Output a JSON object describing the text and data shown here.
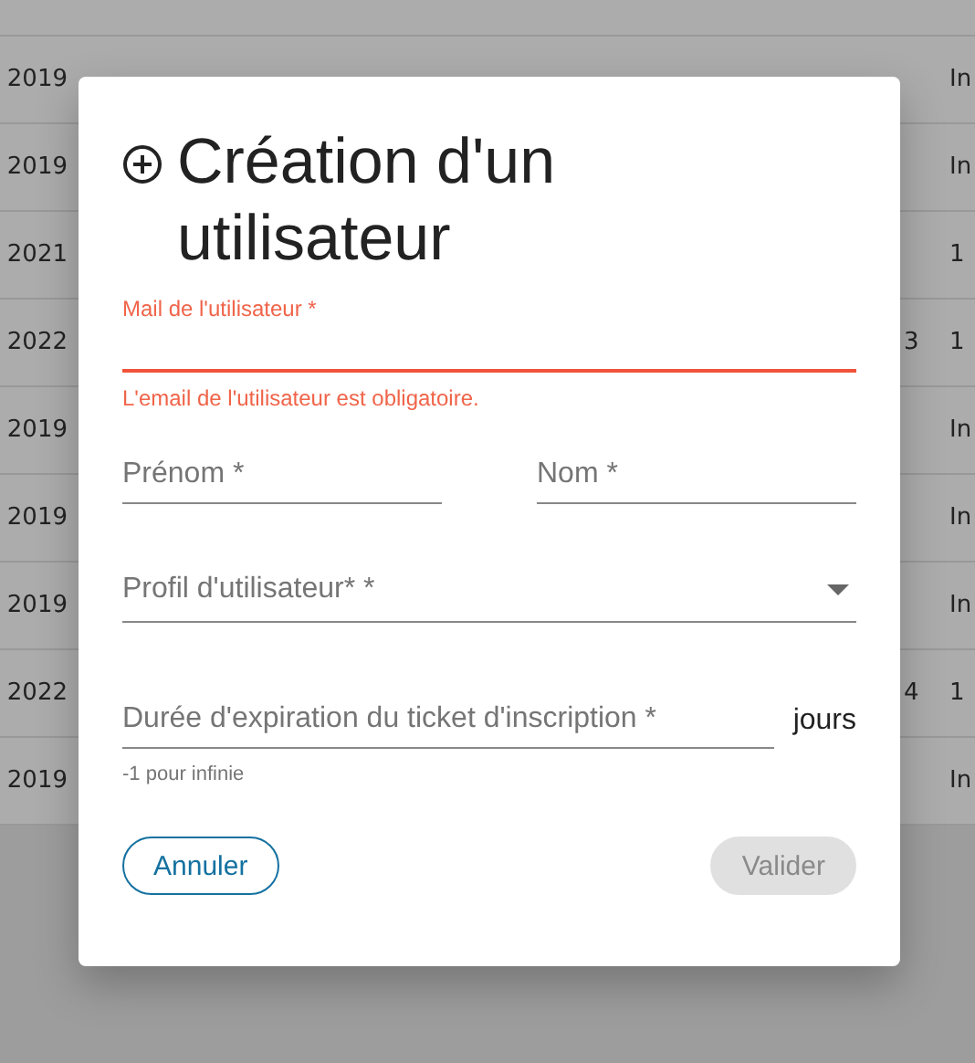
{
  "background_table": {
    "rows": [
      {
        "column_1": "2019",
        "column_3": "In"
      },
      {
        "column_1": "2019",
        "column_3": "In"
      },
      {
        "column_1": "2021",
        "column_3": "1"
      },
      {
        "column_1": "2022",
        "column_2": "3",
        "column_3": "1"
      },
      {
        "column_1": "2019",
        "column_3": "In"
      },
      {
        "column_1": "2019",
        "column_3": "In"
      },
      {
        "column_1": "2019",
        "column_3": "In"
      },
      {
        "column_1": "2022",
        "column_2": "4",
        "column_3": "1"
      },
      {
        "column_1": "2019",
        "column_3": "In"
      }
    ]
  },
  "dialog": {
    "title": "Création d'un utilisateur",
    "email": {
      "label": "Mail de l'utilisateur *",
      "error": "L'email de l'utilisateur est obligatoire."
    },
    "first_name": {
      "placeholder": "Prénom *"
    },
    "last_name": {
      "placeholder": "Nom *"
    },
    "profile": {
      "placeholder": "Profil d'utilisateur* *"
    },
    "expiration": {
      "placeholder": "Durée d'expiration du ticket d'inscription *",
      "suffix": "jours",
      "hint": "-1 pour infinie"
    },
    "buttons": [
      {
        "label": "Annuler",
        "disabled": false
      },
      {
        "label": "Valider",
        "disabled": true
      }
    ]
  }
}
